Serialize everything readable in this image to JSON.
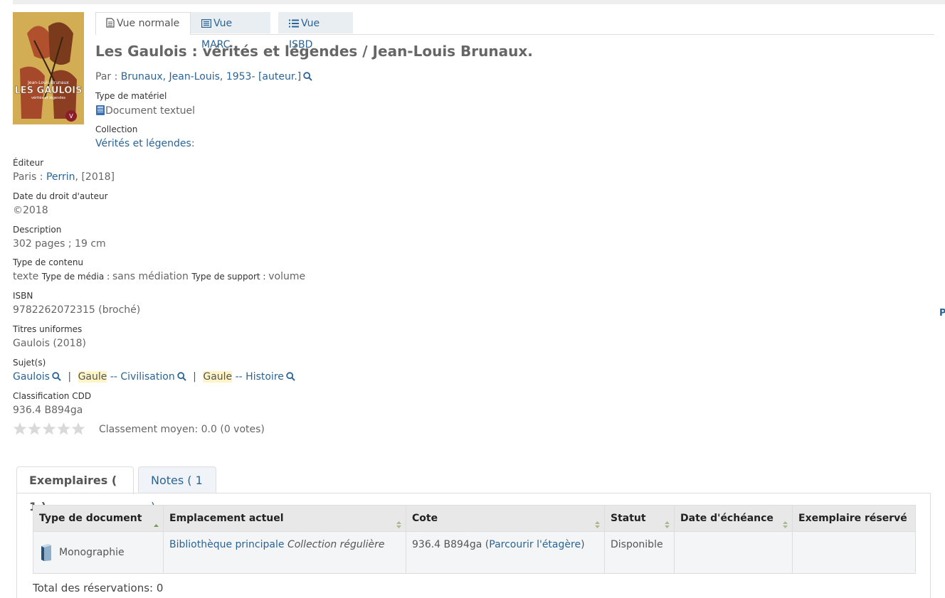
{
  "view_tabs": [
    {
      "label": "Vue normale",
      "active": true,
      "icon": "document-icon"
    },
    {
      "label": "Vue MARC",
      "active": false,
      "icon": "list-table-icon"
    },
    {
      "label": "Vue ISBD",
      "active": false,
      "icon": "list-icon"
    }
  ],
  "cover": {
    "author": "Jean-Louis Brunaux",
    "title": "LES GAULOIS",
    "subtitle": "vérités et légendes"
  },
  "record": {
    "title": "Les Gaulois : vérités et légendes / Jean-Louis Brunaux.",
    "author_prefix": "Par : ",
    "author": "Brunaux, Jean-Louis, 1953- [auteur.]",
    "material_label": "Type de matériel",
    "material_value": "Document textuel",
    "collection_label": "Collection",
    "collection_value": "Vérités et légendes",
    "collection_suffix": ":",
    "publisher_label": "Éditeur",
    "publisher_place": "Paris : ",
    "publisher_name": "Perrin",
    "publisher_date": ", [2018]",
    "copyright_label": "Date du droit d'auteur",
    "copyright_value": "©2018",
    "description_label": "Description",
    "description_value": "302 pages ; 19 cm",
    "content_label": "Type de contenu",
    "content_value": "texte",
    "media_label": "Type de média : ",
    "media_value": "sans médiation",
    "carrier_label": "Type de support : ",
    "carrier_value": "volume",
    "isbn_label": "ISBN",
    "isbn_value": "9782262072315 (broché)",
    "uniform_label": "Titres uniformes",
    "uniform_value": "Gaulois (2018)",
    "subjects_label": "Sujet(s)",
    "subjects": {
      "s1": "Gaulois",
      "s2_hl": "Gaule",
      "s2_rest": " -- Civilisation",
      "s3_hl": "Gaule",
      "s3_rest": " -- Histoire",
      "separator": "|"
    },
    "cdd_label": "Classification CDD",
    "cdd_value": "936.4 B894ga"
  },
  "rating": {
    "stars": 0,
    "max": 5,
    "text": "Classement moyen: 0.0 (0 votes)"
  },
  "holding_tabs": [
    {
      "label": "Exemplaires ( 1 )",
      "active": true
    },
    {
      "label": "Notes ( 1 )",
      "active": false
    }
  ],
  "holdings": {
    "columns": [
      "Type de document",
      "Emplacement actuel",
      "Cote",
      "Statut",
      "Date d'échéance",
      "Exemplaire réservé"
    ],
    "row": {
      "type": "Monographie",
      "location_link": "Bibliothèque principale",
      "location_coll": "Collection régulière",
      "callnumber": "936.4 B894ga",
      "browse_open": " (",
      "browse_link": "Parcourir l'étagère",
      "browse_close": ")",
      "status": "Disponible",
      "due": "",
      "reserved": ""
    },
    "total": "Total des réservations: 0"
  },
  "edge_letter": "P",
  "colors": {
    "link": "#2a6496",
    "highlight": "#fff4c6",
    "available": "#2f7d2f"
  }
}
